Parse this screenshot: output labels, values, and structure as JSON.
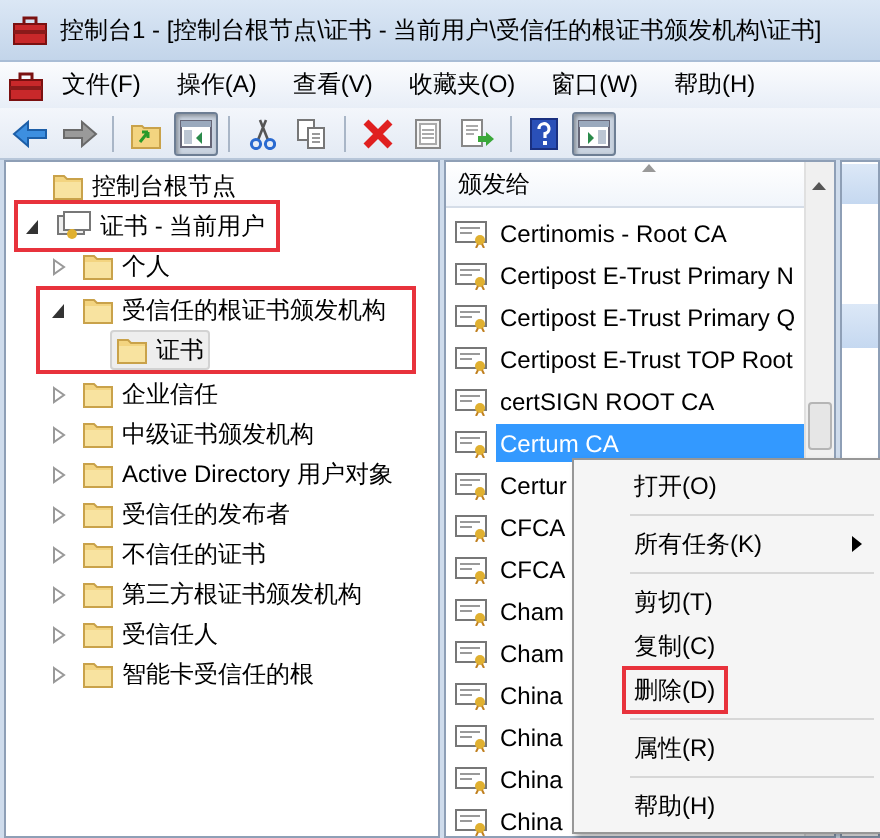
{
  "window": {
    "title": "控制台1 - [控制台根节点\\证书 - 当前用户\\受信任的根证书颁发机构\\证书]"
  },
  "menu": [
    "文件(F)",
    "操作(A)",
    "查看(V)",
    "收藏夹(O)",
    "窗口(W)",
    "帮助(H)"
  ],
  "toolbar": [
    [
      {
        "kind": "back",
        "pressed": false
      },
      {
        "kind": "forward",
        "pressed": false
      }
    ],
    [
      {
        "kind": "up",
        "pressed": false
      },
      {
        "kind": "tree",
        "pressed": true
      }
    ],
    [
      {
        "kind": "cut",
        "pressed": false
      },
      {
        "kind": "copy",
        "pressed": false
      }
    ],
    [
      {
        "kind": "delete",
        "pressed": false
      },
      {
        "kind": "properties",
        "pressed": false
      },
      {
        "kind": "export",
        "pressed": false
      }
    ],
    [
      {
        "kind": "help",
        "pressed": false
      },
      {
        "kind": "pane",
        "pressed": true
      }
    ]
  ],
  "tree": [
    {
      "label": "控制台根节点",
      "kind": "folder",
      "selected": false,
      "children": [
        {
          "label": "证书 - 当前用户",
          "kind": "store",
          "expanded": true,
          "selected": false,
          "row_boxed": true,
          "children": [
            {
              "label": "个人",
              "kind": "folder",
              "expanded": false,
              "selected": false
            },
            {
              "label": "受信任的根证书颁发机构",
              "kind": "folder",
              "expanded": true,
              "selected": false,
              "group_boxed": true,
              "children": [
                {
                  "label": "证书",
                  "kind": "folder",
                  "selected": true
                }
              ]
            },
            {
              "label": "企业信任",
              "kind": "folder",
              "expanded": false,
              "selected": false
            },
            {
              "label": "中级证书颁发机构",
              "kind": "folder",
              "expanded": false,
              "selected": false
            },
            {
              "label": "Active Directory 用户对象",
              "kind": "folder",
              "expanded": false,
              "selected": false
            },
            {
              "label": "受信任的发布者",
              "kind": "folder",
              "expanded": false,
              "selected": false
            },
            {
              "label": "不信任的证书",
              "kind": "folder",
              "expanded": false,
              "selected": false
            },
            {
              "label": "第三方根证书颁发机构",
              "kind": "folder",
              "expanded": false,
              "selected": false
            },
            {
              "label": "受信任人",
              "kind": "folder",
              "expanded": false,
              "selected": false
            },
            {
              "label": "智能卡受信任的根",
              "kind": "folder",
              "expanded": false,
              "selected": false
            }
          ]
        }
      ]
    }
  ],
  "list": {
    "column": "颁发给",
    "rows": [
      {
        "name": "Certinomis - Root CA",
        "selected": false
      },
      {
        "name": "Certipost E-Trust Primary N",
        "selected": false
      },
      {
        "name": "Certipost E-Trust Primary Q",
        "selected": false
      },
      {
        "name": "Certipost E-Trust TOP Root",
        "selected": false
      },
      {
        "name": "certSIGN ROOT CA",
        "selected": false
      },
      {
        "name": "Certum CA",
        "selected": true
      },
      {
        "name": "Certur",
        "selected": false
      },
      {
        "name": "CFCA",
        "selected": false
      },
      {
        "name": "CFCA",
        "selected": false
      },
      {
        "name": "Cham",
        "selected": false
      },
      {
        "name": "Cham",
        "selected": false
      },
      {
        "name": "China",
        "selected": false
      },
      {
        "name": "China",
        "selected": false
      },
      {
        "name": "China",
        "selected": false
      },
      {
        "name": "China",
        "selected": false
      }
    ]
  },
  "context_menu": [
    {
      "label": "打开(O)",
      "submenu": false,
      "highlighted": false,
      "separator_after": true
    },
    {
      "label": "所有任务(K)",
      "submenu": true,
      "highlighted": false,
      "separator_after": true
    },
    {
      "label": "剪切(T)",
      "submenu": false,
      "highlighted": false,
      "separator_after": false
    },
    {
      "label": "复制(C)",
      "submenu": false,
      "highlighted": false,
      "separator_after": false
    },
    {
      "label": "删除(D)",
      "submenu": false,
      "highlighted": true,
      "separator_after": true
    },
    {
      "label": "属性(R)",
      "submenu": false,
      "highlighted": false,
      "separator_after": true
    },
    {
      "label": "帮助(H)",
      "submenu": false,
      "highlighted": false,
      "separator_after": false
    }
  ]
}
